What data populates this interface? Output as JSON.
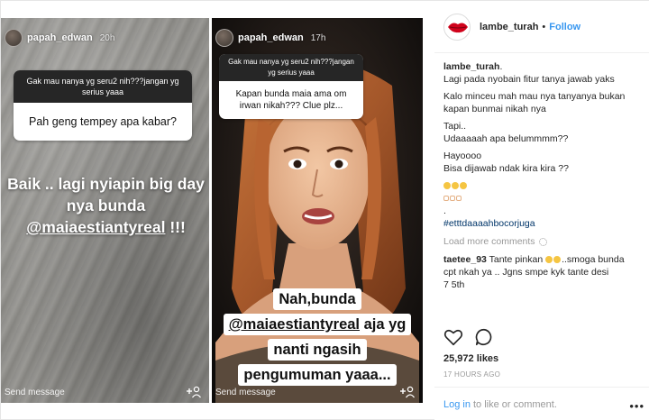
{
  "story1": {
    "username": "papah_edwan",
    "time": "20h",
    "question": "Gak mau nanya yg seru2 nih???jangan yg serius yaaa",
    "answer": "Pah geng tempey apa kabar?",
    "caption_line1": "Baik .. lagi nyiapin big day",
    "caption_line2": "nya bunda",
    "caption_mention": "@maiaestiantyreal",
    "caption_end": "!!!",
    "send_message": "Send message"
  },
  "story2": {
    "username": "papah_edwan",
    "time": "17h",
    "question": "Gak mau nanya yg seru2 nih???jangan yg serius yaaa",
    "answer": "Kapan bunda maia ama om irwan nikah??? Clue plz...",
    "speech_line1": "Nah,bunda",
    "speech_mention": "@maiaestiantyreal",
    "speech_line2_end": "aja yg",
    "speech_line3": "nanti ngasih",
    "speech_line4": "pengumuman yaaa...",
    "send_message": "Send message"
  },
  "post": {
    "account": "lambe_turah",
    "follow": "Follow",
    "caption": {
      "user": "lambe_turah",
      "user_suffix": ".",
      "lines": [
        "Lagi pada nyobain fitur tanya jawab yaks",
        "",
        "Kalo minceu mah mau nya tanyanya bukan",
        "kapan bunmai nikah nya",
        "",
        "Tapi..",
        "Udaaaaah apa belummmm??",
        "",
        "Hayoooo",
        "Bisa dijawab ndak kira kira ??"
      ],
      "dot": ".",
      "hashtag": "#etttdaaaahbocorjuga"
    },
    "load_more": "Load more comments",
    "comment": {
      "user": "taetee_93",
      "text1": "Tante pinkan",
      "text2": "..smoga bunda",
      "text3": "cpt nkah ya .. Jgns smpe kyk tante desi",
      "text4": "7 5th"
    },
    "likes": "25,972 likes",
    "time_ago": "17 HOURS AGO",
    "login": "Log in",
    "login_suffix": "to like or comment."
  },
  "colors": {
    "link_blue": "#3897f0",
    "hashtag": "#003569",
    "question_header": "#262626",
    "logo_red": "#d0021b"
  },
  "icons": {
    "heart": "heart-icon",
    "comment": "comment-icon",
    "add_person": "add-person-icon",
    "lips_logo": "lips-logo-icon",
    "more": "more-options-icon"
  }
}
